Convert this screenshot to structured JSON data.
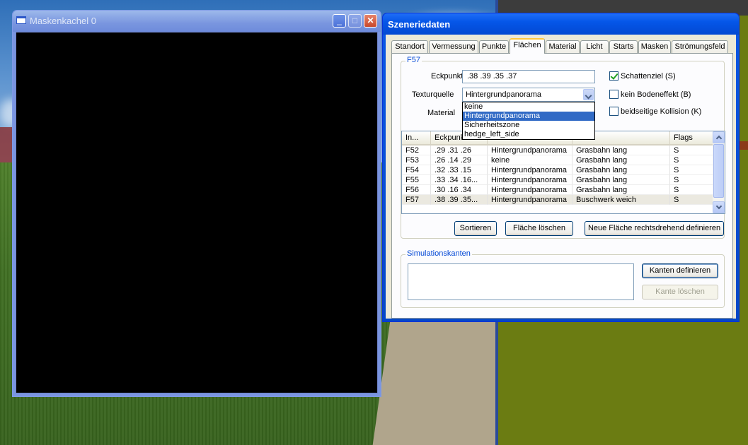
{
  "mask_window": {
    "title": "Maskenkachel 0",
    "buttons": {
      "minimize": "_",
      "maximize": "□",
      "close": "✕"
    }
  },
  "scene_window": {
    "title": "Szeneriedaten",
    "tabs": [
      "Standort",
      "Vermessung",
      "Punkte",
      "Flächen",
      "Material",
      "Licht",
      "Starts",
      "Masken",
      "Strömungsfeld"
    ],
    "active_tab": "Flächen",
    "face_group": {
      "label": "F57",
      "eckpunkte_label": "Eckpunkte",
      "eckpunkte_value": ".38 .39 .35 .37",
      "texturquelle_label": "Texturquelle",
      "texturquelle_value": "Hintergrundpanorama",
      "texturquelle_options": [
        "keine",
        "Hintergrundpanorama",
        "Sicherheitszone",
        "hedge_left_side"
      ],
      "texturquelle_selected_index": 1,
      "material_label": "Material",
      "checkboxes": [
        {
          "label": "Schattenziel (S)",
          "checked": true
        },
        {
          "label": "kein Bodeneffekt (B)",
          "checked": false
        },
        {
          "label": "beidseitige Kollision (K)",
          "checked": false
        }
      ]
    },
    "table": {
      "columns": [
        "In...",
        "Eckpunk",
        "",
        "rial",
        "Flags"
      ],
      "rows": [
        [
          "F52",
          ".29 .31 .26",
          "Hintergrundpanorama",
          "Grasbahn lang",
          "S"
        ],
        [
          "F53",
          ".26 .14 .29",
          "keine",
          "Grasbahn lang",
          "S"
        ],
        [
          "F54",
          ".32 .33 .15",
          "Hintergrundpanorama",
          "Grasbahn lang",
          "S"
        ],
        [
          "F55",
          ".33 .34 .16...",
          "Hintergrundpanorama",
          "Grasbahn lang",
          "S"
        ],
        [
          "F56",
          ".30 .16 .34",
          "Hintergrundpanorama",
          "Grasbahn lang",
          "S"
        ],
        [
          "F57",
          ".38 .39 .35...",
          "Hintergrundpanorama",
          "Buschwerk weich",
          "S"
        ]
      ],
      "selected_row": 5
    },
    "buttons": {
      "sort": "Sortieren",
      "delete_face": "Fläche löschen",
      "new_face": "Neue Fläche rechtsdrehend definieren"
    },
    "sim_group": {
      "label": "Simulationskanten",
      "define_button": "Kanten definieren",
      "delete_button": "Kante löschen"
    }
  }
}
